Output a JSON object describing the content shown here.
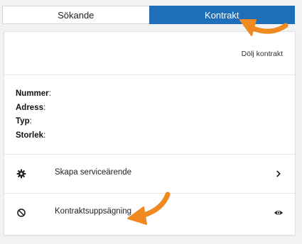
{
  "tabs": [
    {
      "label": "Sökande",
      "active": false
    },
    {
      "label": "Kontrakt",
      "active": true
    }
  ],
  "card": {
    "hide_link": "Dölj kontrakt",
    "fields": [
      {
        "label": "Nummer",
        "value": ""
      },
      {
        "label": "Adress",
        "value": ""
      },
      {
        "label": "Typ",
        "value": ""
      },
      {
        "label": "Storlek",
        "value": ""
      }
    ],
    "actions": [
      {
        "label": "Skapa serviceärende",
        "icon": "gear-icon",
        "right_icon": "chevron-right-icon"
      },
      {
        "label": "Kontraktsuppsägning",
        "icon": "ban-icon",
        "right_icon": "eye-icon"
      }
    ]
  },
  "colors": {
    "tab_active_bg": "#1f6fb8",
    "annotation_arrow": "#f0891f"
  }
}
